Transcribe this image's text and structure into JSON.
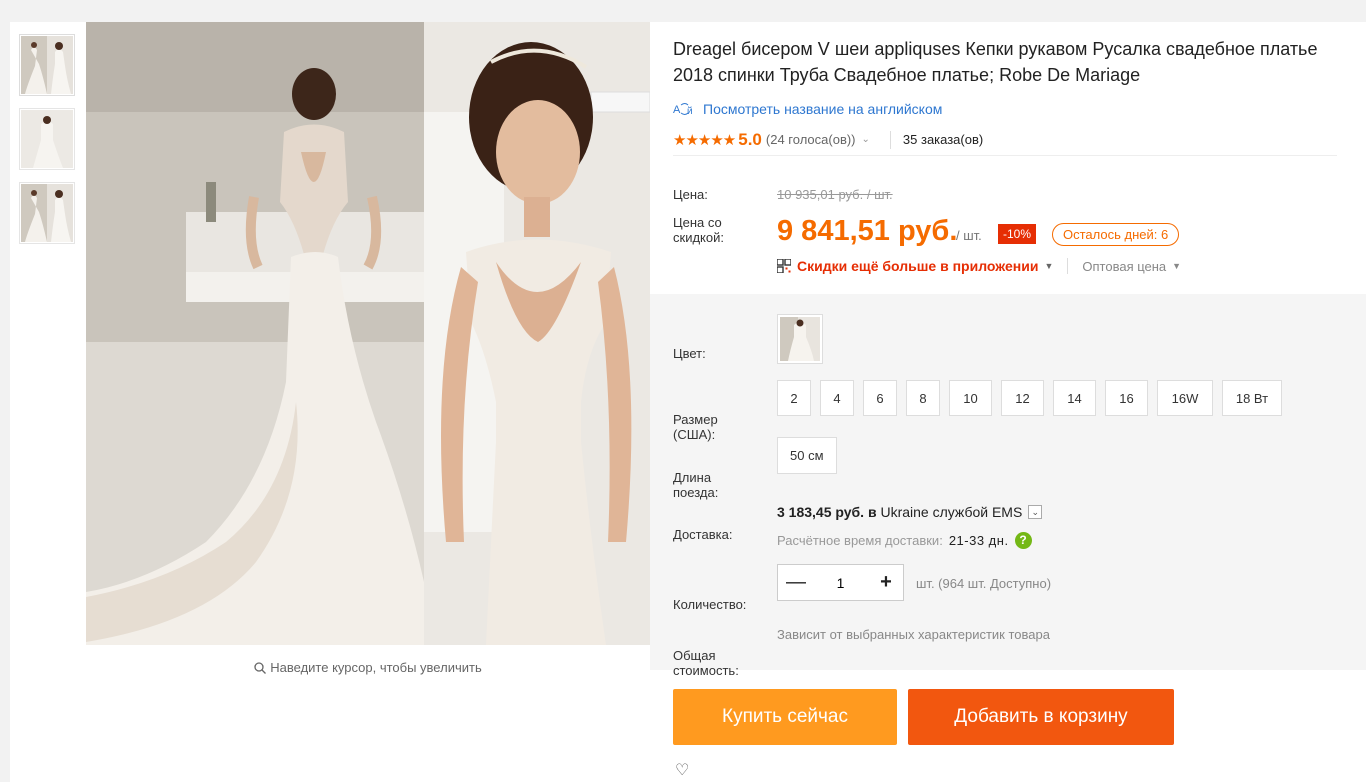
{
  "gallery": {
    "thumbnails": [
      {
        "name": "thumb-1"
      },
      {
        "name": "thumb-2"
      },
      {
        "name": "thumb-3"
      }
    ],
    "zoom_hint": "Наведите курсор, чтобы увеличить"
  },
  "product": {
    "title": "Dreagel бисером V шеи appliquses Кепки рукавом Русалка свадебное платье 2018 спинки Труба Свадебное платье; Robe De Mariage",
    "translate_link": "Посмотреть название на английском",
    "rating": {
      "stars": "★★★★★",
      "score": "5.0",
      "votes": "(24 голоса(ов))",
      "orders": "35 заказа(ов)"
    }
  },
  "pricing": {
    "price_label": "Цена:",
    "old_price": "10 935,01 руб. / шт.",
    "discount_label_line1": "Цена со",
    "discount_label_line2": "скидкой:",
    "new_price": "9 841,51 руб.",
    "per_unit": "/ шт.",
    "discount_badge": "-10%",
    "days_left": "Осталось дней: 6",
    "app_discount": "Скидки ещё больше в приложении",
    "wholesale": "Оптовая цена"
  },
  "sku": {
    "color_label": "Цвет:",
    "size_label_line1": "Размер",
    "size_label_line2": "(США):",
    "sizes": [
      "2",
      "4",
      "6",
      "8",
      "10",
      "12",
      "14",
      "16",
      "16W",
      "18 Вт"
    ],
    "train_label_line1": "Длина",
    "train_label_line2": "поезда:",
    "train_value": "50 см",
    "shipping_label": "Доставка:",
    "shipping_price": "3 183,45 руб.",
    "shipping_text_in": "в",
    "shipping_dest": "Ukraine службой EMS",
    "eta_label": "Расчётное время доставки:",
    "eta_value": "21-33 дн.",
    "qty_label": "Количество:",
    "qty_value": "1",
    "qty_minus": "—",
    "qty_plus": "+",
    "available": "шт. (964 шт. Доступно)",
    "total_label_line1": "Общая",
    "total_label_line2": "стоимость:",
    "total_value": "Зависит от выбранных характеристик товара"
  },
  "actions": {
    "buy_now": "Купить сейчас",
    "add_to_cart": "Добавить в корзину"
  },
  "colors": {
    "accent_orange": "#f56b00",
    "buy_button": "#ff9a1f",
    "cart_button": "#f2570f",
    "link_blue": "#2e77d0",
    "badge_red": "#e62e04"
  }
}
